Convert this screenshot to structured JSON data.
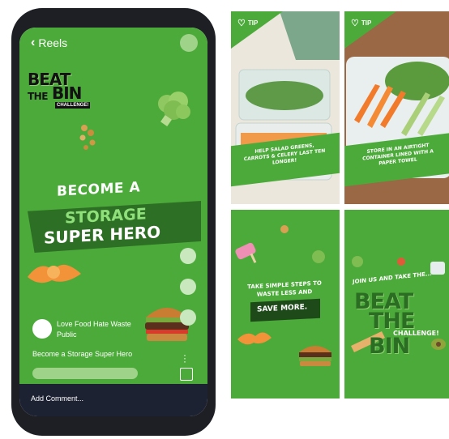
{
  "reel": {
    "back_label": "Reels",
    "logo": {
      "line1": "BEAT",
      "line2a": "THE",
      "line2b": "BIN",
      "line3": "CHALLENGE!"
    },
    "headline": {
      "line1": "BECOME A",
      "line2": "STORAGE",
      "line3": "SUPER HERO"
    },
    "account_name": "Love Food Hate Waste",
    "account_visibility": "Public",
    "caption": "Become a Storage Super Hero",
    "comment_placeholder": "Add Comment..."
  },
  "tiles": [
    {
      "tip_label": "TIP",
      "text": "HELP SALAD GREENS, CARROTS & CELERY LAST TEN LONGER!"
    },
    {
      "tip_label": "TIP",
      "text": "STORE IN AN AIRTIGHT CONTAINER LINED WITH A PAPER TOWEL"
    },
    {
      "text": "TAKE SIMPLE STEPS TO WASTE LESS AND",
      "button": "SAVE MORE."
    },
    {
      "join": "JOIN US AND TAKE THE...",
      "beat": "BEAT",
      "the_bin": "THE BIN",
      "challenge": "CHALLENGE!"
    }
  ],
  "colors": {
    "brand_green": "#4caa3a",
    "dark_green": "#2d6f24",
    "phone_frame": "#1d1f24",
    "comment_bar": "#1d2233"
  },
  "icons": [
    "back-chevron-icon",
    "heart-icon",
    "more-icon",
    "bookmark-icon"
  ]
}
